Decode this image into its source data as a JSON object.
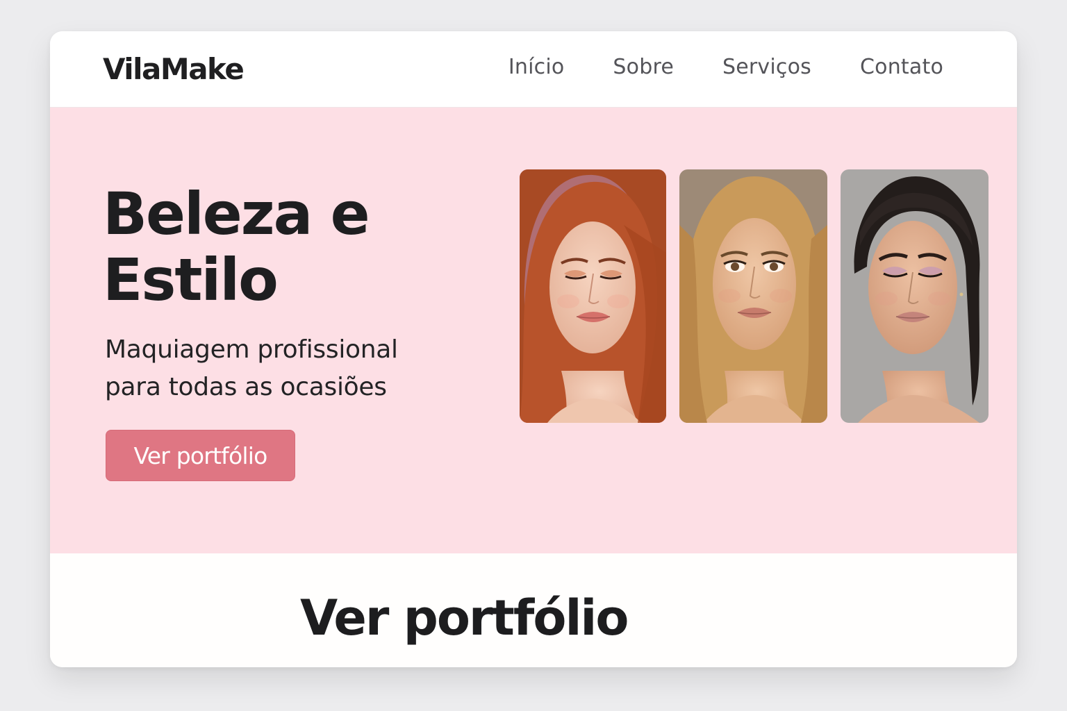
{
  "header": {
    "logo": "VilaMake",
    "nav": [
      {
        "label": "Início"
      },
      {
        "label": "Sobre"
      },
      {
        "label": "Serviços"
      },
      {
        "label": "Contato"
      }
    ]
  },
  "hero": {
    "title_line1": "Beleza e",
    "title_line2": "Estilo",
    "subtitle_line1": "Maquiagem profissional",
    "subtitle_line2": "para todas as ocasiões",
    "cta_label": "Ver portfólio",
    "gallery": [
      {
        "subject": "woman-red-hair-portrait"
      },
      {
        "subject": "woman-blonde-wavy-hair-portrait"
      },
      {
        "subject": "woman-dark-hair-portrait"
      }
    ]
  },
  "portfolio": {
    "title": "Ver portfólio"
  },
  "colors": {
    "hero_background": "#fddfe5",
    "accent": "#df7683",
    "page_background": "#ececee"
  }
}
